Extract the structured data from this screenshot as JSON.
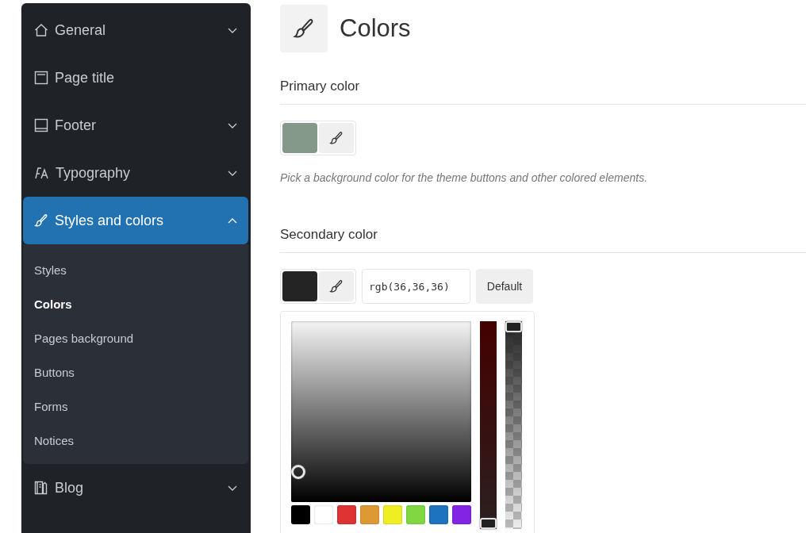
{
  "sidebar": {
    "items": [
      {
        "label": "General",
        "kind": "group",
        "expanded": false,
        "selected": false
      },
      {
        "label": "Page title",
        "kind": "link",
        "selected": false
      },
      {
        "label": "Footer",
        "kind": "group",
        "expanded": false,
        "selected": false
      },
      {
        "label": "Typography",
        "kind": "group",
        "expanded": false,
        "selected": false
      },
      {
        "label": "Styles and colors",
        "kind": "group",
        "expanded": true,
        "selected": true,
        "children": [
          {
            "label": "Styles",
            "selected": false
          },
          {
            "label": "Colors",
            "selected": true
          },
          {
            "label": "Pages background",
            "selected": false
          },
          {
            "label": "Buttons",
            "selected": false
          },
          {
            "label": "Forms",
            "selected": false
          },
          {
            "label": "Notices",
            "selected": false
          }
        ]
      },
      {
        "label": "Blog",
        "kind": "group",
        "expanded": false,
        "selected": false
      }
    ]
  },
  "page": {
    "title": "Colors"
  },
  "sections": [
    {
      "title": "Primary color",
      "color": "#84998a",
      "hint": "Pick a background color for the theme buttons and other colored elements."
    },
    {
      "title": "Secondary color",
      "color": "#242424",
      "value": "rgb(36,36,36)",
      "default_button": "Default",
      "picker": {
        "area_marker": {
          "level": 0.14
        },
        "hue_slider": {
          "level": 0
        },
        "alpha_slider": {
          "level": 1
        },
        "swatches": [
          {
            "color": "#000000"
          },
          {
            "color": "#ffffff"
          },
          {
            "color": "#dd3333"
          },
          {
            "color": "#dd9933"
          },
          {
            "color": "#eeee22"
          },
          {
            "color": "#81d742"
          },
          {
            "color": "#1e73be"
          },
          {
            "color": "#8224e3"
          }
        ]
      }
    }
  ]
}
